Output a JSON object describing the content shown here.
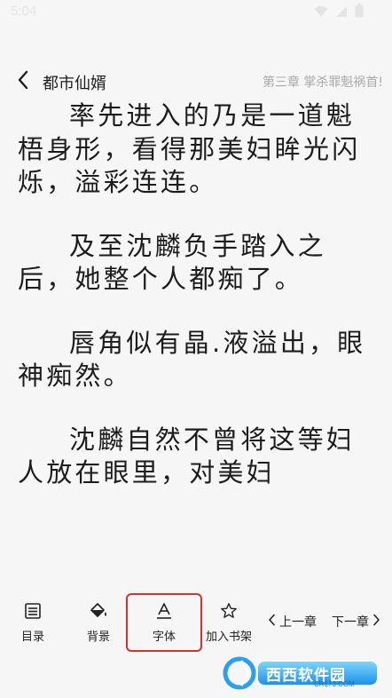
{
  "status_bar": {
    "time": "5:04"
  },
  "header": {
    "book_title": "都市仙婿",
    "chapter_title": "第三章 掌杀罪魁祸首!"
  },
  "content": {
    "paragraphs": [
      "率先进入的乃是一道魁梧身形，看得那美妇眸光闪烁，溢彩连连。",
      "及至沈麟负手踏入之后，她整个人都痴了。",
      "唇角似有晶.液溢出，眼神痴然。",
      "沈麟自然不曾将这等妇人放在眼里，对美妇"
    ]
  },
  "toolbar": {
    "toc_label": "目录",
    "background_label": "背景",
    "font_label": "字体",
    "bookshelf_label": "加入书架",
    "prev_label": "上一章",
    "next_label": "下一章"
  },
  "watermark": {
    "brand": "西西软件园",
    "url": "CR173.COM"
  },
  "colors": {
    "background": "#f6f6f6",
    "text": "#1c1c1c",
    "chapter_title": "#a9a9a9",
    "highlight": "#d9302c"
  },
  "icons": {
    "back": "chevron-left-icon",
    "toc": "list-icon",
    "background": "paint-bucket-icon",
    "font": "font-a-icon",
    "bookshelf": "star-icon",
    "prev": "chevron-left-icon",
    "next": "chevron-right-icon"
  }
}
